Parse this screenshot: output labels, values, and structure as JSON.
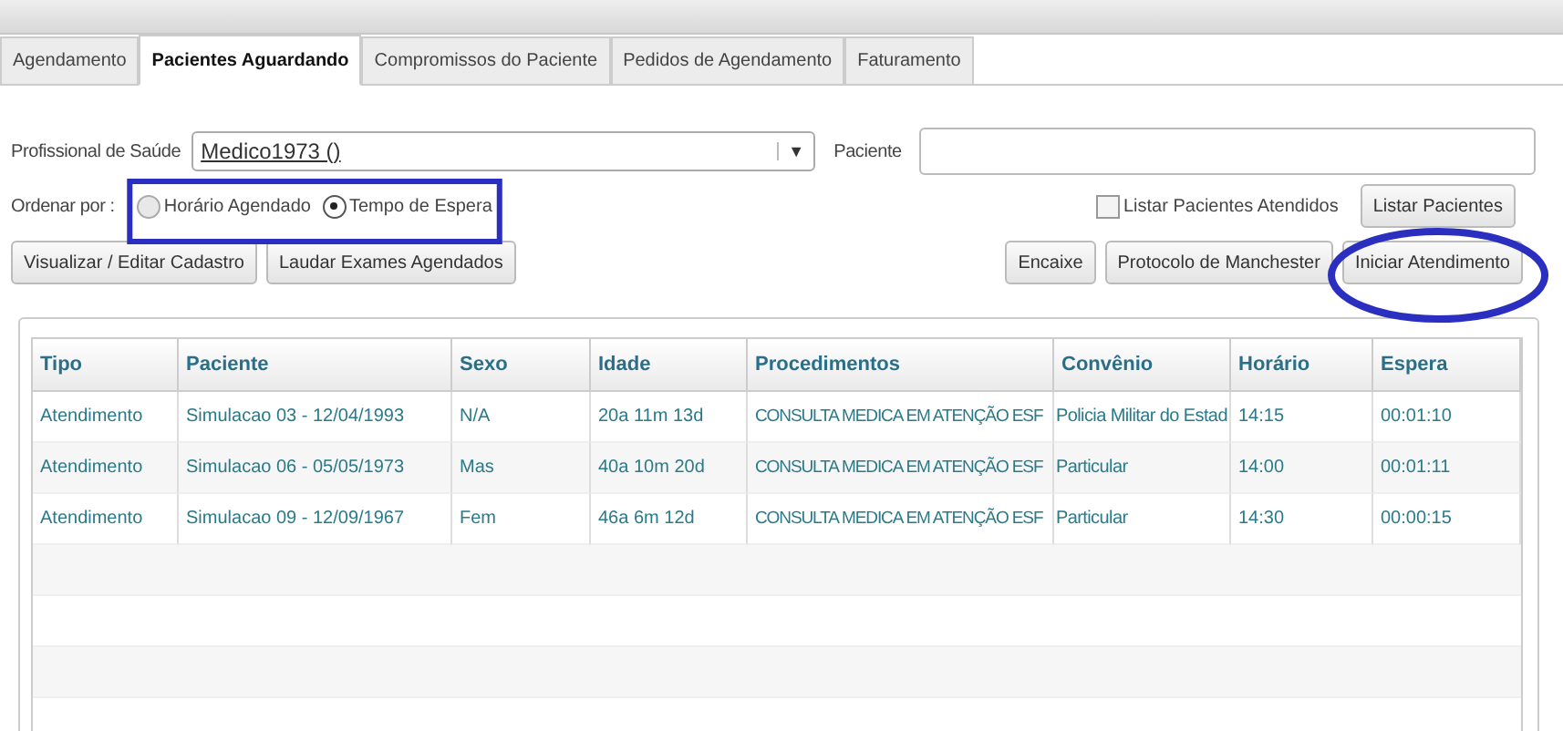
{
  "tabs": [
    {
      "label": "Agendamento",
      "selected": false
    },
    {
      "label": "Pacientes Aguardando",
      "selected": true
    },
    {
      "label": "Compromissos do Paciente",
      "selected": false
    },
    {
      "label": "Pedidos de Agendamento",
      "selected": false
    },
    {
      "label": "Faturamento",
      "selected": false
    }
  ],
  "professional": {
    "label": "Profissional de Saúde",
    "value": "Medico1973 ()",
    "arrow": "▼"
  },
  "patient": {
    "label": "Paciente"
  },
  "sort": {
    "label": "Ordenar por :",
    "options": [
      {
        "label": "Horário Agendado",
        "selected": false
      },
      {
        "label": "Tempo de Espera",
        "selected": true
      }
    ]
  },
  "list_attended": {
    "label": "Listar Pacientes Atendidos",
    "checked": false
  },
  "left_buttons": [
    "Visualizar / Editar Cadastro",
    "Laudar Exames Agendados"
  ],
  "list_button": "Listar Pacientes",
  "right_buttons": [
    "Encaixe",
    "Protocolo de Manchester",
    "Iniciar Atendimento"
  ],
  "table": {
    "columns": [
      "Tipo",
      "Paciente",
      "Sexo",
      "Idade",
      "Procedimentos",
      "Convênio",
      "Horário",
      "Espera"
    ],
    "rows": [
      [
        "Atendimento",
        "Simulacao 03 - 12/04/1993",
        "N/A",
        "20a 11m 13d",
        "CONSULTA MEDICA EM ATENÇÃO ESF",
        "Policia Militar do Estad",
        "14:15",
        "00:01:10"
      ],
      [
        "Atendimento",
        "Simulacao 06 - 05/05/1973",
        "Mas",
        "40a 10m 20d",
        "CONSULTA MEDICA EM ATENÇÃO ESF",
        "Particular",
        "14:00",
        "00:01:11"
      ],
      [
        "Atendimento",
        "Simulacao 09 - 12/09/1967",
        "Fem",
        "46a 6m 12d",
        "CONSULTA MEDICA EM ATENÇÃO ESF",
        "Particular",
        "14:30",
        "00:00:15"
      ]
    ]
  }
}
